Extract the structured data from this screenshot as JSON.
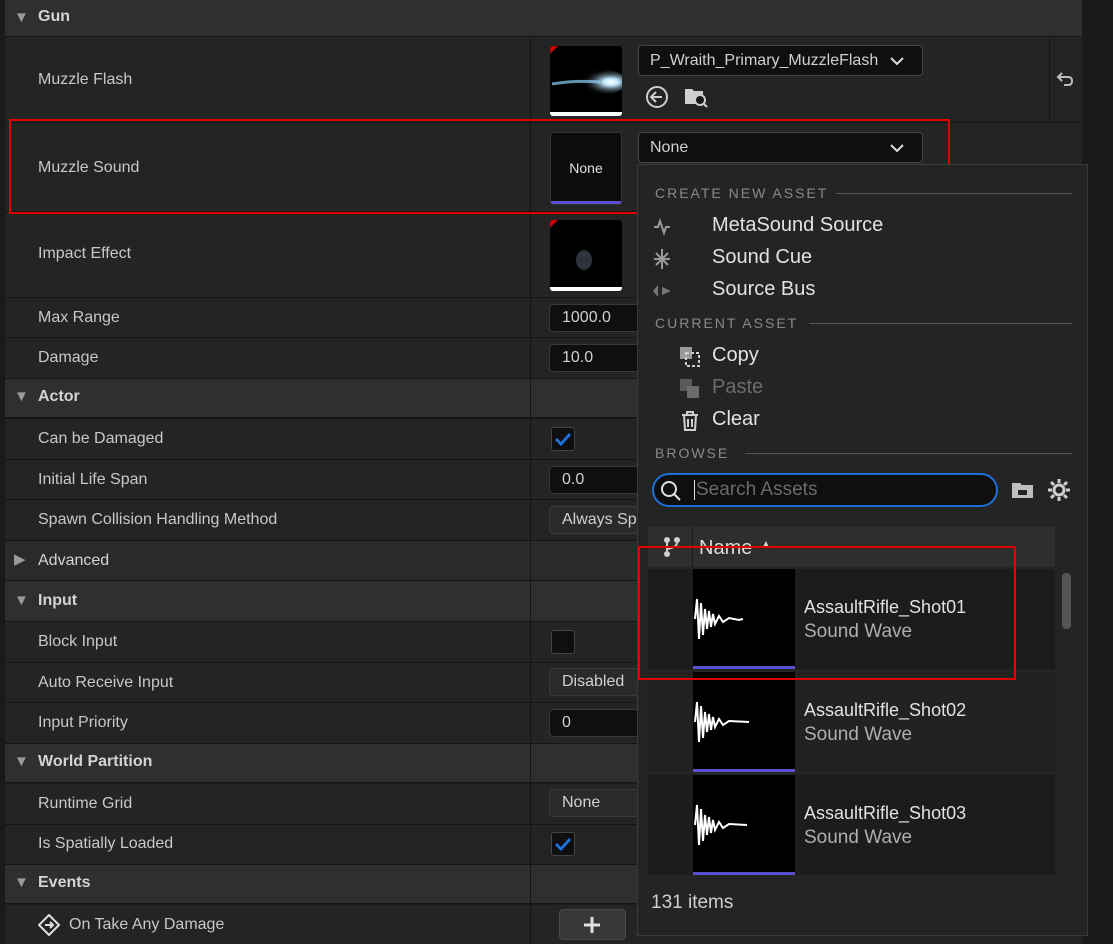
{
  "sections": {
    "gun": "Gun",
    "actor": "Actor",
    "advanced": "Advanced",
    "input": "Input",
    "world_partition": "World Partition",
    "events": "Events"
  },
  "properties": {
    "muzzle_flash": {
      "label": "Muzzle Flash",
      "value": "P_Wraith_Primary_MuzzleFlash"
    },
    "muzzle_sound": {
      "label": "Muzzle Sound",
      "value": "None",
      "thumb_text": "None"
    },
    "impact_effect": {
      "label": "Impact Effect"
    },
    "max_range": {
      "label": "Max Range",
      "value": "1000.0"
    },
    "damage": {
      "label": "Damage",
      "value": "10.0"
    },
    "can_be_damaged": {
      "label": "Can be Damaged",
      "checked": true
    },
    "initial_life_span": {
      "label": "Initial Life Span",
      "value": "0.0"
    },
    "spawn_collision": {
      "label": "Spawn Collision Handling Method",
      "value": "Always Spa"
    },
    "block_input": {
      "label": "Block Input",
      "checked": false
    },
    "auto_receive_input": {
      "label": "Auto Receive Input",
      "value": "Disabled"
    },
    "input_priority": {
      "label": "Input Priority",
      "value": "0"
    },
    "runtime_grid": {
      "label": "Runtime Grid",
      "value": "None"
    },
    "is_spatially_loaded": {
      "label": "Is Spatially Loaded",
      "checked": true
    },
    "on_take_any_damage": {
      "label": "On Take Any Damage"
    }
  },
  "popup": {
    "create_header": "CREATE NEW ASSET",
    "create_items": [
      "MetaSound Source",
      "Sound Cue",
      "Source Bus"
    ],
    "current_header": "CURRENT ASSET",
    "current_items": [
      "Copy",
      "Paste",
      "Clear"
    ],
    "browse_header": "BROWSE",
    "search_placeholder": "Search Assets",
    "column_name": "Name",
    "assets": [
      {
        "name": "AssaultRifle_Shot01",
        "type": "Sound Wave"
      },
      {
        "name": "AssaultRifle_Shot02",
        "type": "Sound Wave"
      },
      {
        "name": "AssaultRifle_Shot03",
        "type": "Sound Wave"
      }
    ],
    "item_count": "131 items"
  },
  "colors": {
    "accent_blue": "#1e6fd9",
    "highlight_red": "#e00000",
    "sound_wave_bar": "#5a4fcf"
  }
}
